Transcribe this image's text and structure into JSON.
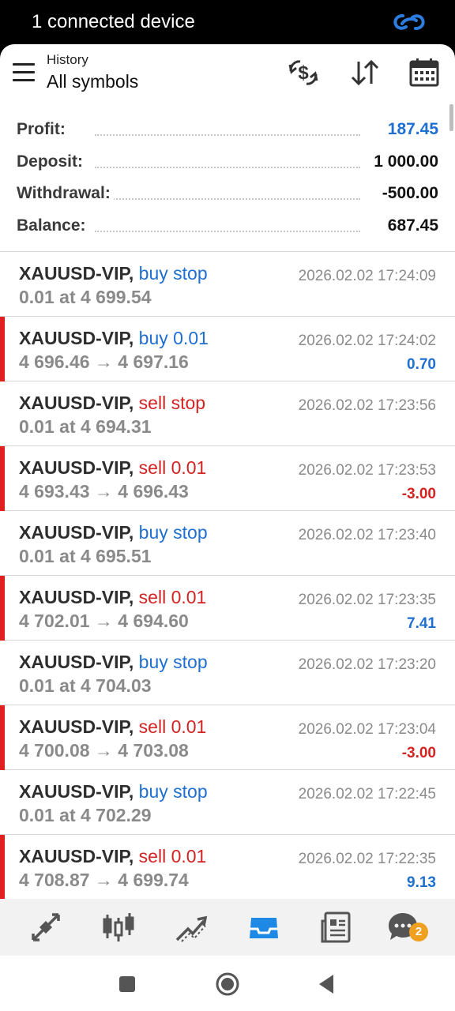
{
  "status_bar": {
    "text": "1 connected device",
    "link_icon": "link-icon"
  },
  "header": {
    "subtitle": "History",
    "title": "All symbols",
    "icons": [
      "menu-icon",
      "currency-icon",
      "sort-icon",
      "calendar-icon"
    ]
  },
  "summary": [
    {
      "label": "Profit:",
      "value": "187.45",
      "accent": "#1e6fd0"
    },
    {
      "label": "Deposit:",
      "value": "1 000.00"
    },
    {
      "label": "Withdrawal:",
      "value": "-500.00"
    },
    {
      "label": "Balance:",
      "value": "687.45"
    }
  ],
  "orders": [
    {
      "symbol": "XAUUSD-VIP,",
      "type": "buy stop",
      "side": "buy",
      "detail": "0.01 at 4 699.54",
      "time": "2026.02.02 17:24:09",
      "pnl": "",
      "filled": false
    },
    {
      "symbol": "XAUUSD-VIP,",
      "type": "buy 0.01",
      "side": "buy",
      "detail": "4 696.46 → 4 697.16",
      "time": "2026.02.02 17:24:02",
      "pnl": "0.70",
      "filled": true
    },
    {
      "symbol": "XAUUSD-VIP,",
      "type": "sell stop",
      "side": "sell",
      "detail": "0.01 at 4 694.31",
      "time": "2026.02.02 17:23:56",
      "pnl": "",
      "filled": false
    },
    {
      "symbol": "XAUUSD-VIP,",
      "type": "sell 0.01",
      "side": "sell",
      "detail": "4 693.43 → 4 696.43",
      "time": "2026.02.02 17:23:53",
      "pnl": "-3.00",
      "filled": true
    },
    {
      "symbol": "XAUUSD-VIP,",
      "type": "buy stop",
      "side": "buy",
      "detail": "0.01 at 4 695.51",
      "time": "2026.02.02 17:23:40",
      "pnl": "",
      "filled": false
    },
    {
      "symbol": "XAUUSD-VIP,",
      "type": "sell 0.01",
      "side": "sell",
      "detail": "4 702.01 → 4 694.60",
      "time": "2026.02.02 17:23:35",
      "pnl": "7.41",
      "filled": true
    },
    {
      "symbol": "XAUUSD-VIP,",
      "type": "buy stop",
      "side": "buy",
      "detail": "0.01 at 4 704.03",
      "time": "2026.02.02 17:23:20",
      "pnl": "",
      "filled": false
    },
    {
      "symbol": "XAUUSD-VIP,",
      "type": "sell 0.01",
      "side": "sell",
      "detail": "4 700.08 → 4 703.08",
      "time": "2026.02.02 17:23:04",
      "pnl": "-3.00",
      "filled": true
    },
    {
      "symbol": "XAUUSD-VIP,",
      "type": "buy stop",
      "side": "buy",
      "detail": "0.01 at 4 702.29",
      "time": "2026.02.02 17:22:45",
      "pnl": "",
      "filled": false
    },
    {
      "symbol": "XAUUSD-VIP,",
      "type": "sell 0.01",
      "side": "sell",
      "detail": "4 708.87 → 4 699.74",
      "time": "2026.02.02 17:22:35",
      "pnl": "9.13",
      "filled": true
    }
  ],
  "bottom_nav": {
    "items": [
      "quotes-icon",
      "chart-icon",
      "trade-icon",
      "history-icon",
      "news-icon",
      "chat-icon"
    ],
    "active": "history-icon",
    "chat_badge": "2"
  },
  "colors": {
    "buy": "#1e6fd0",
    "sell": "#d32424",
    "filled_marker": "#e0201f"
  }
}
